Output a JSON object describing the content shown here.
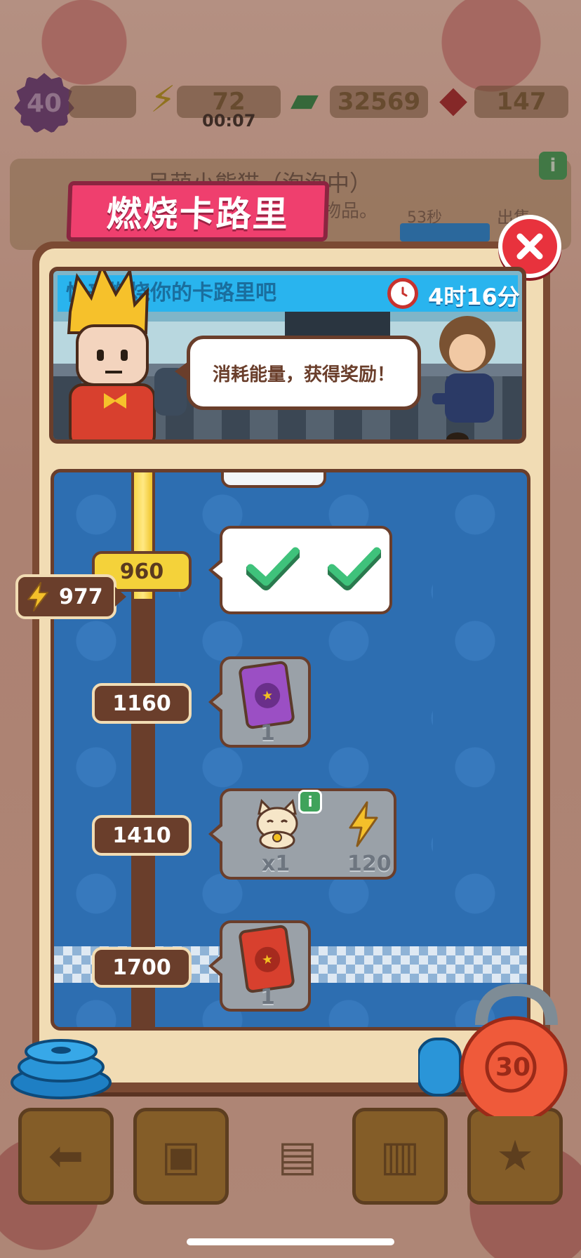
{
  "colors": {
    "accent_pink": "#ef3f6e",
    "panel_brown": "#6a3e2b",
    "track_blue": "#2d6eb1",
    "energy_yellow": "#f4d23a",
    "check_green": "#3fc27b",
    "close_red": "#e8323d"
  },
  "background": {
    "level": "40",
    "energy": "72",
    "energy_timer": "00:07",
    "cash": "32569",
    "gems": "147",
    "npc_name": "呆萌小熊猫（泡泡中）",
    "npc_item_text": "物品。",
    "npc_timer": "53秒",
    "npc_action": "出售"
  },
  "popup": {
    "title": "燃烧卡路里",
    "header_title": "快来燃烧你的卡路里吧",
    "time_left": "4时16分",
    "speech": "消耗能量，获得奖励！",
    "current_energy": "977",
    "kettlebell_level": "30"
  },
  "milestones": [
    {
      "threshold": "960",
      "reached": true,
      "claimed": true
    },
    {
      "threshold": "1160",
      "reached": false,
      "reward_icon": "purple-snack-bag-icon",
      "reward_count": "1"
    },
    {
      "threshold": "1410",
      "reached": false,
      "rewards": [
        {
          "icon": "lucky-cat-icon",
          "count": "x1"
        },
        {
          "icon": "energy-bolt-icon",
          "count": "120"
        }
      ]
    },
    {
      "threshold": "1700",
      "reached": false,
      "reward_icon": "red-snack-bag-icon",
      "reward_count": "1"
    }
  ],
  "icons": {
    "close": "close-icon",
    "timer": "clock-icon",
    "energy": "energy-bolt-icon",
    "check": "checkmark-icon",
    "info": "info-icon"
  }
}
